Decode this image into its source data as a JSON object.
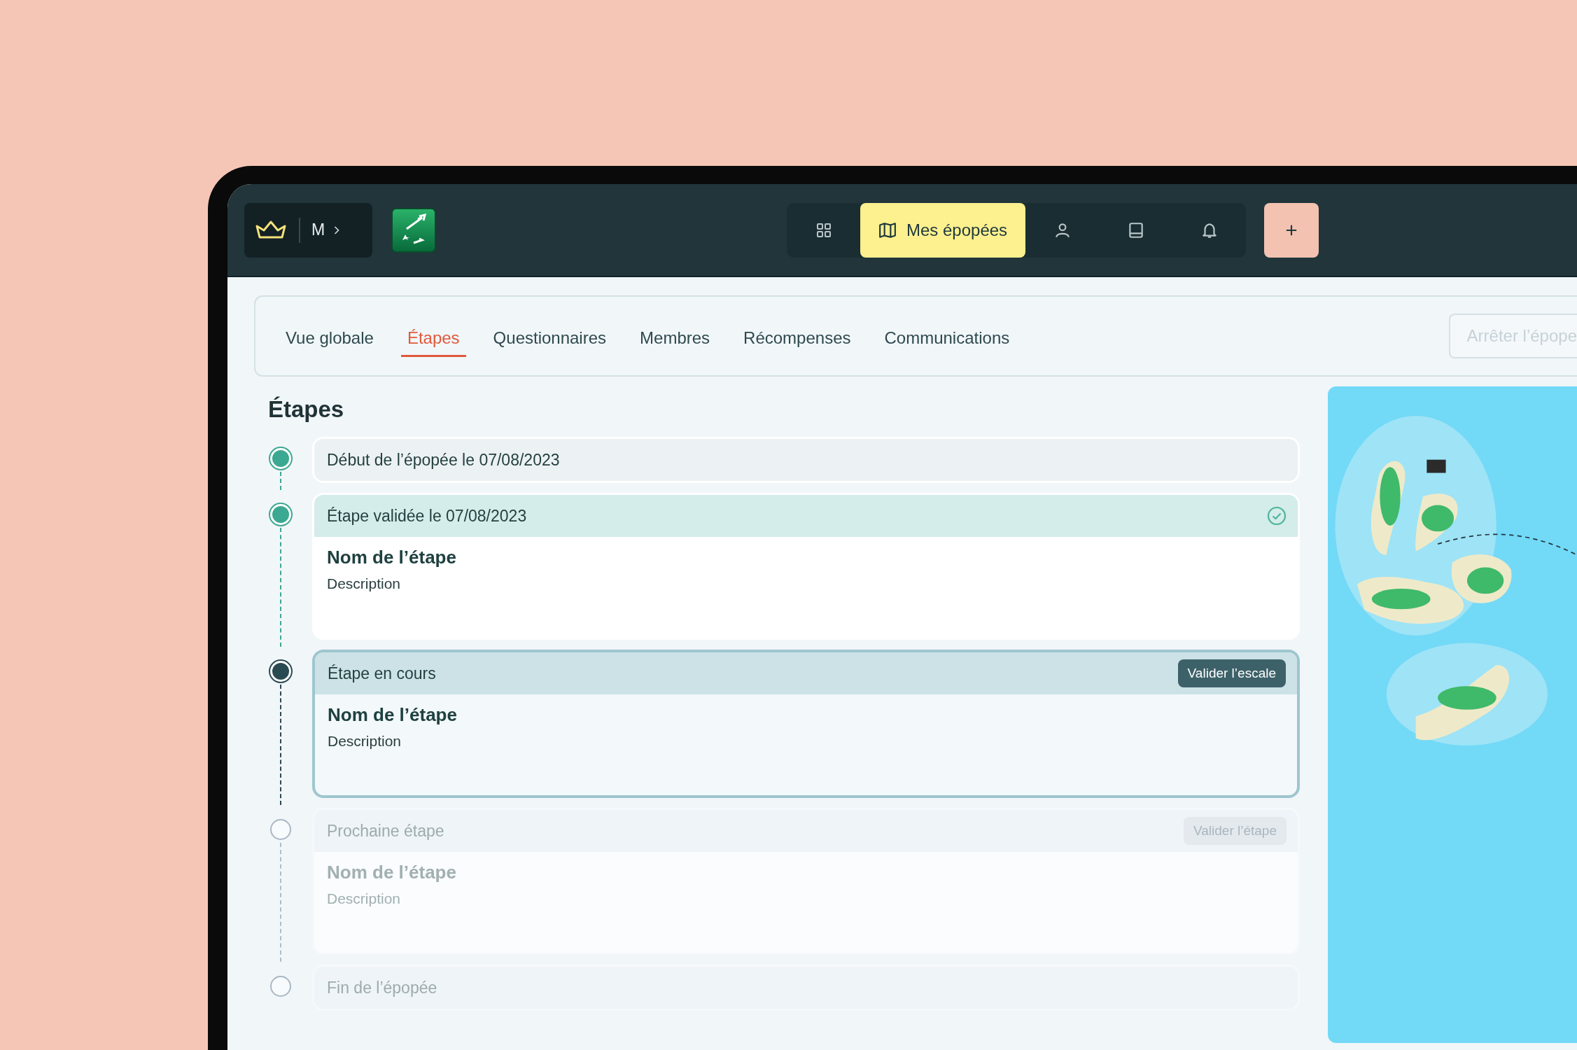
{
  "top_bar": {
    "workspace_initial": "M",
    "nav": [
      {
        "selected": false
      },
      {
        "label": "Mes épopées",
        "selected": true
      },
      {
        "selected": false
      },
      {
        "selected": false
      },
      {
        "selected": false
      }
    ]
  },
  "tabs": [
    {
      "label": "Vue globale",
      "selected": false
    },
    {
      "label": "Étapes",
      "selected": true
    },
    {
      "label": "Questionnaires",
      "selected": false
    },
    {
      "label": "Membres",
      "selected": false
    },
    {
      "label": "Récompenses",
      "selected": false
    },
    {
      "label": "Communications",
      "selected": false
    }
  ],
  "stop_button": {
    "label": "Arrêter l’épope",
    "disabled": true
  },
  "section_title": "Étapes",
  "steps": [
    {
      "kind": "marker",
      "completed": true,
      "active": false,
      "label": "Début de l’épopée le 07/08/2023"
    },
    {
      "kind": "step",
      "completed": true,
      "active": false,
      "label": "Étape validée le 07/08/2023",
      "name": "Nom de l’étape",
      "description": "Description"
    },
    {
      "kind": "step",
      "completed": false,
      "active": true,
      "label": "Étape en cours",
      "action": {
        "label": "Valider l’escale",
        "disabled": false
      },
      "name": "Nom de l’étape",
      "description": "Description"
    },
    {
      "kind": "step",
      "completed": false,
      "active": false,
      "label": "Prochaine étape",
      "action": {
        "label": "Valider l’étape",
        "disabled": true
      },
      "name": "Nom de l’étape",
      "description": "Description"
    },
    {
      "kind": "marker",
      "completed": false,
      "active": false,
      "label": "Fin de l’épopée"
    }
  ]
}
